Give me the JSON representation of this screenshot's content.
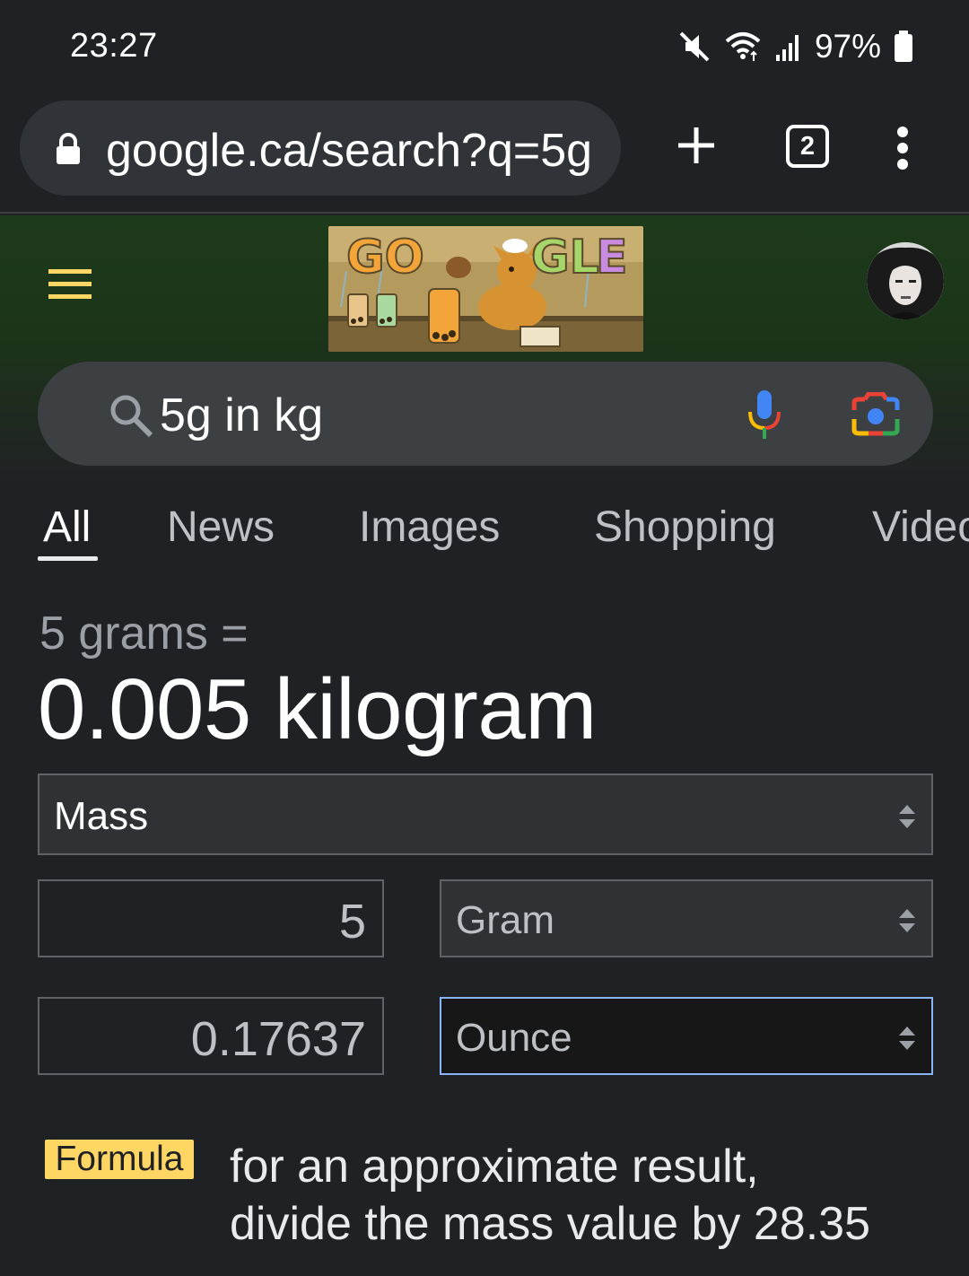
{
  "status_bar": {
    "time": "23:27",
    "battery": "97%",
    "icons": [
      "mute-icon",
      "wifi-icon",
      "signal-icon",
      "battery-icon"
    ]
  },
  "browser": {
    "url": "google.ca/search?q=5g",
    "tab_count": "2",
    "icons": [
      "lock-icon",
      "new-tab-icon",
      "tab-switcher-icon",
      "more-menu-icon"
    ]
  },
  "google": {
    "search_query": "5g in kg",
    "doodle_alt": "GOOGLE",
    "tabs": [
      {
        "label": "All",
        "active": true
      },
      {
        "label": "News",
        "active": false
      },
      {
        "label": "Images",
        "active": false
      },
      {
        "label": "Shopping",
        "active": false
      },
      {
        "label": "Videos",
        "active": false
      }
    ]
  },
  "converter": {
    "input_label": "5 grams =",
    "result": "0.005 kilogram",
    "category": "Mass",
    "from_value": "5",
    "from_unit": "Gram",
    "to_value": "0.17637",
    "to_unit": "Ounce",
    "formula_badge": "Formula",
    "formula_line1": "for an approximate result,",
    "formula_line2": "divide the mass value by 28.35"
  },
  "colors": {
    "background": "#202124",
    "header_green": "#1d3a1b",
    "formula_badge": "#fdd663",
    "focus_blue": "#8ab4f8"
  }
}
